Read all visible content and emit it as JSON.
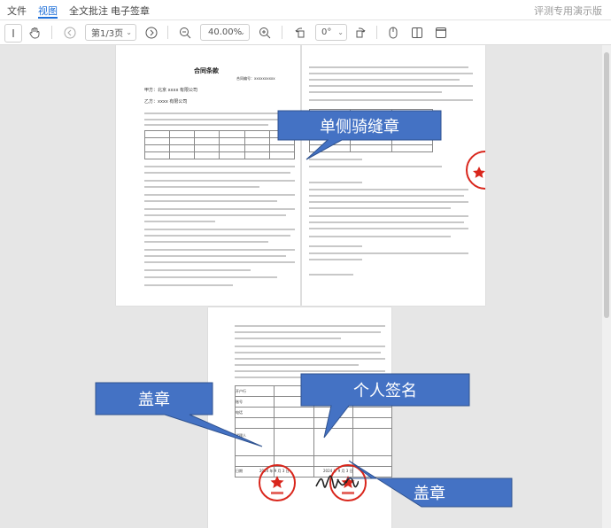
{
  "menu": {
    "items": [
      {
        "label": "文件"
      },
      {
        "label": "视图"
      },
      {
        "label": "全文批注"
      },
      {
        "label": "电子签章"
      }
    ],
    "right_label": "评测专用演示版"
  },
  "toolbar": {
    "page_indicator": "第1/3页",
    "zoom": "40.00%",
    "rotation": "0°"
  },
  "document": {
    "page1_title": "合同条款",
    "page1_contract_no": "合同编号：xxxxxxxxxx",
    "page1_party_a": "甲方：北京 xxxx 有限公司",
    "page1_party_b": "乙方：xxxx 有限公司",
    "page3_row_labels": [
      "开户行",
      "账号",
      "电话",
      "代理人",
      "日期"
    ],
    "page3_dates": [
      "2024 年 9 月 3 日",
      "2024 年 9 月 3 日"
    ]
  },
  "callouts": {
    "seam_seal": "单侧骑缝章",
    "seal_left": "盖章",
    "personal_sign": "个人签名",
    "seal_right": "盖章"
  },
  "colors": {
    "accent": "#1e6fd9",
    "callout_fill": "#4472c4",
    "callout_stroke": "#2f528f",
    "seal_red": "#d9261c"
  }
}
